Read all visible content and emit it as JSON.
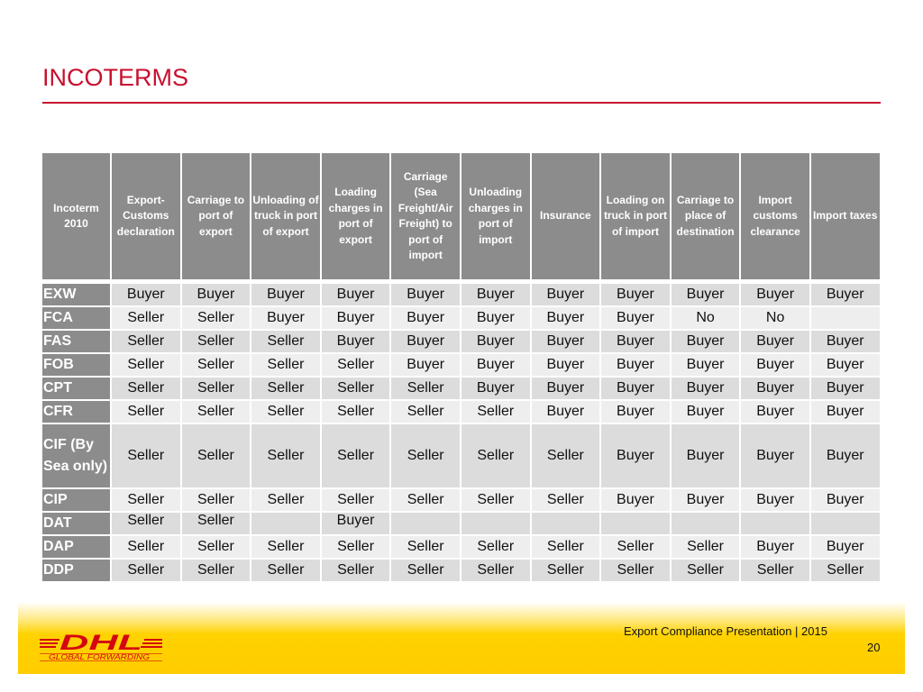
{
  "slide": {
    "title": "INCOTERMS",
    "accent_color": "#c8102e",
    "footer_text": "Export Compliance Presentation | 2015",
    "page_number": "20",
    "logo": {
      "brand": "DHL",
      "subtitle": "GLOBAL FORWARDING",
      "brand_color": "#d40511",
      "background_color": "#ffcc00"
    }
  },
  "table": {
    "header_color": "#8c8c8c",
    "headers": [
      "Incoterm 2010",
      "Export-Customs declaration",
      "Carriage to port of export",
      "Unloading of truck in port of export",
      "Loading charges in port of export",
      "Carriage (Sea Freight/Air Freight) to port of import",
      "Unloading charges in port of import",
      "Insurance",
      "Loading on truck in port of import",
      "Carriage to place of destination",
      "Import customs clearance",
      "Import taxes"
    ],
    "rows": [
      {
        "term": "EXW",
        "values": [
          "Buyer",
          "Buyer",
          "Buyer",
          "Buyer",
          "Buyer",
          "Buyer",
          "Buyer",
          "Buyer",
          "Buyer",
          "Buyer",
          "Buyer"
        ]
      },
      {
        "term": "FCA",
        "values": [
          "Seller",
          "Seller",
          "Buyer",
          "Buyer",
          "Buyer",
          "Buyer",
          "Buyer",
          "Buyer",
          "No",
          "No",
          ""
        ]
      },
      {
        "term": "FAS",
        "values": [
          "Seller",
          "Seller",
          "Seller",
          "Buyer",
          "Buyer",
          "Buyer",
          "Buyer",
          "Buyer",
          "Buyer",
          "Buyer",
          "Buyer"
        ]
      },
      {
        "term": "FOB",
        "values": [
          "Seller",
          "Seller",
          "Seller",
          "Seller",
          "Buyer",
          "Buyer",
          "Buyer",
          "Buyer",
          "Buyer",
          "Buyer",
          "Buyer"
        ]
      },
      {
        "term": "CPT",
        "values": [
          "Seller",
          "Seller",
          "Seller",
          "Seller",
          "Seller",
          "Buyer",
          "Buyer",
          "Buyer",
          "Buyer",
          "Buyer",
          "Buyer"
        ]
      },
      {
        "term": "CFR",
        "values": [
          "Seller",
          "Seller",
          "Seller",
          "Seller",
          "Seller",
          "Seller",
          "Buyer",
          "Buyer",
          "Buyer",
          "Buyer",
          "Buyer"
        ]
      },
      {
        "term": "CIF (By Sea only)",
        "values": [
          "Seller",
          "Seller",
          "Seller",
          "Seller",
          "Seller",
          "Seller",
          "Seller",
          "Buyer",
          "Buyer",
          "Buyer",
          "Buyer"
        ]
      },
      {
        "term": "CIP",
        "values": [
          "Seller",
          "Seller",
          "Seller",
          "Seller",
          "Seller",
          "Seller",
          "Seller",
          "Buyer",
          "Buyer",
          "Buyer",
          "Buyer"
        ]
      },
      {
        "term": "DAT",
        "values": [
          "Seller",
          "Seller",
          "",
          "Buyer",
          "",
          "",
          "",
          "",
          "",
          "",
          ""
        ]
      },
      {
        "term": "DAP",
        "values": [
          "Seller",
          "Seller",
          "Seller",
          "Seller",
          "Seller",
          "Seller",
          "Seller",
          "Seller",
          "Seller",
          "Buyer",
          "Buyer"
        ]
      },
      {
        "term": "DDP",
        "values": [
          "Seller",
          "Seller",
          "Seller",
          "Seller",
          "Seller",
          "Seller",
          "Seller",
          "Seller",
          "Seller",
          "Seller",
          "Seller"
        ]
      }
    ]
  }
}
